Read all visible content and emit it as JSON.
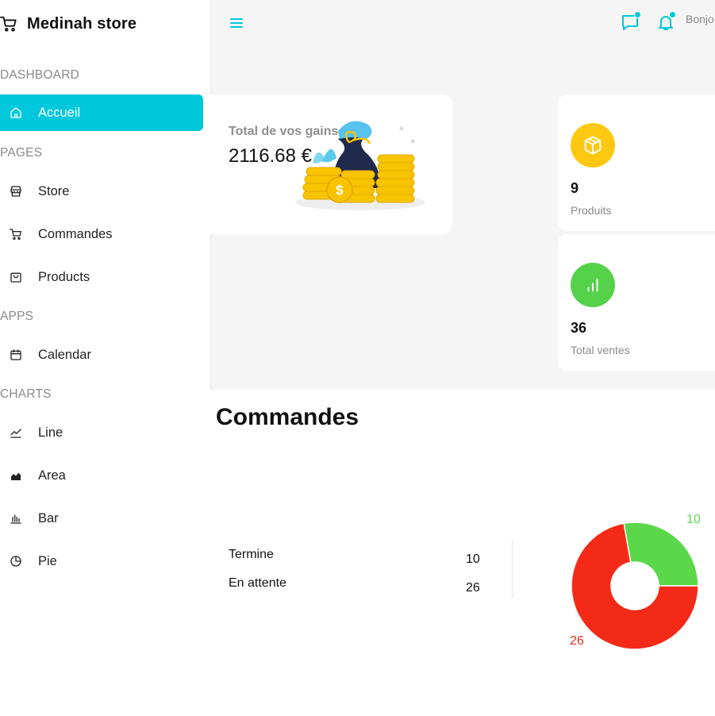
{
  "app": {
    "title": "Medinah store"
  },
  "sidebar": {
    "sections": {
      "dashboard": "DASHBOARD",
      "pages": "PAGES",
      "apps": "APPS",
      "charts": "CHARTS"
    },
    "items": {
      "accueil": "Accueil",
      "store": "Store",
      "commandes": "Commandes",
      "products": "Products",
      "calendar": "Calendar",
      "line": "Line",
      "area": "Area",
      "bar": "Bar",
      "pie": "Pie"
    }
  },
  "topbar": {
    "greeting": "Bonjo"
  },
  "gains": {
    "title": "Total de vos gains",
    "amount": "2116.68 €"
  },
  "stats": {
    "products": {
      "value": "9",
      "label": "Produits"
    },
    "sales": {
      "value": "36",
      "label": "Total ventes"
    }
  },
  "orders": {
    "title": "Commandes",
    "rows": [
      {
        "label": "Termine",
        "value": "10"
      },
      {
        "label": "En attente",
        "value": "26"
      }
    ]
  },
  "chart_data": {
    "type": "pie",
    "categories": [
      "Termine",
      "En attente"
    ],
    "values": [
      10,
      26
    ],
    "colors": [
      "#5ad84a",
      "#f42a18"
    ],
    "labels": [
      "10",
      "26"
    ]
  },
  "colors": {
    "accent": "#00c8dc",
    "products_circle": "#fdc80f",
    "sales_circle": "#55d14a"
  }
}
